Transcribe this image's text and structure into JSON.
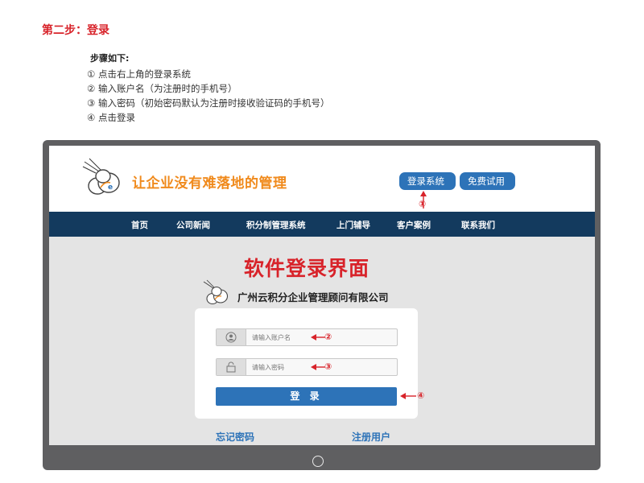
{
  "step_title": "第二步：登录",
  "steps_heading": "步骤如下:",
  "steps": [
    "① 点击右上角的登录系统",
    "② 输入账户名（为注册时的手机号）",
    "③ 输入密码（初始密码默认为注册时接收验证码的手机号）",
    "④ 点击登录"
  ],
  "site": {
    "slogan": "让企业没有难落地的管理",
    "header_buttons": {
      "login": "登录系统",
      "trial": "免费试用"
    },
    "nav": [
      "首页",
      "公司新闻",
      "积分制管理系统",
      "上门辅导",
      "客户案例",
      "联系我们"
    ]
  },
  "login_page": {
    "title": "软件登录界面",
    "company": "广州云积分企业管理顾问有限公司",
    "account_placeholder": "请输入账户名",
    "password_placeholder": "请输入密码",
    "login_button": "登 录",
    "forgot_password": "忘记密码",
    "register": "注册用户"
  },
  "callouts": {
    "c1": "①",
    "c2": "②",
    "c3": "③",
    "c4": "④"
  },
  "colors": {
    "accent_red": "#d8232a",
    "brand_blue": "#2d73b8",
    "nav_dark": "#133a5e",
    "slogan_orange": "#f08a1c"
  }
}
